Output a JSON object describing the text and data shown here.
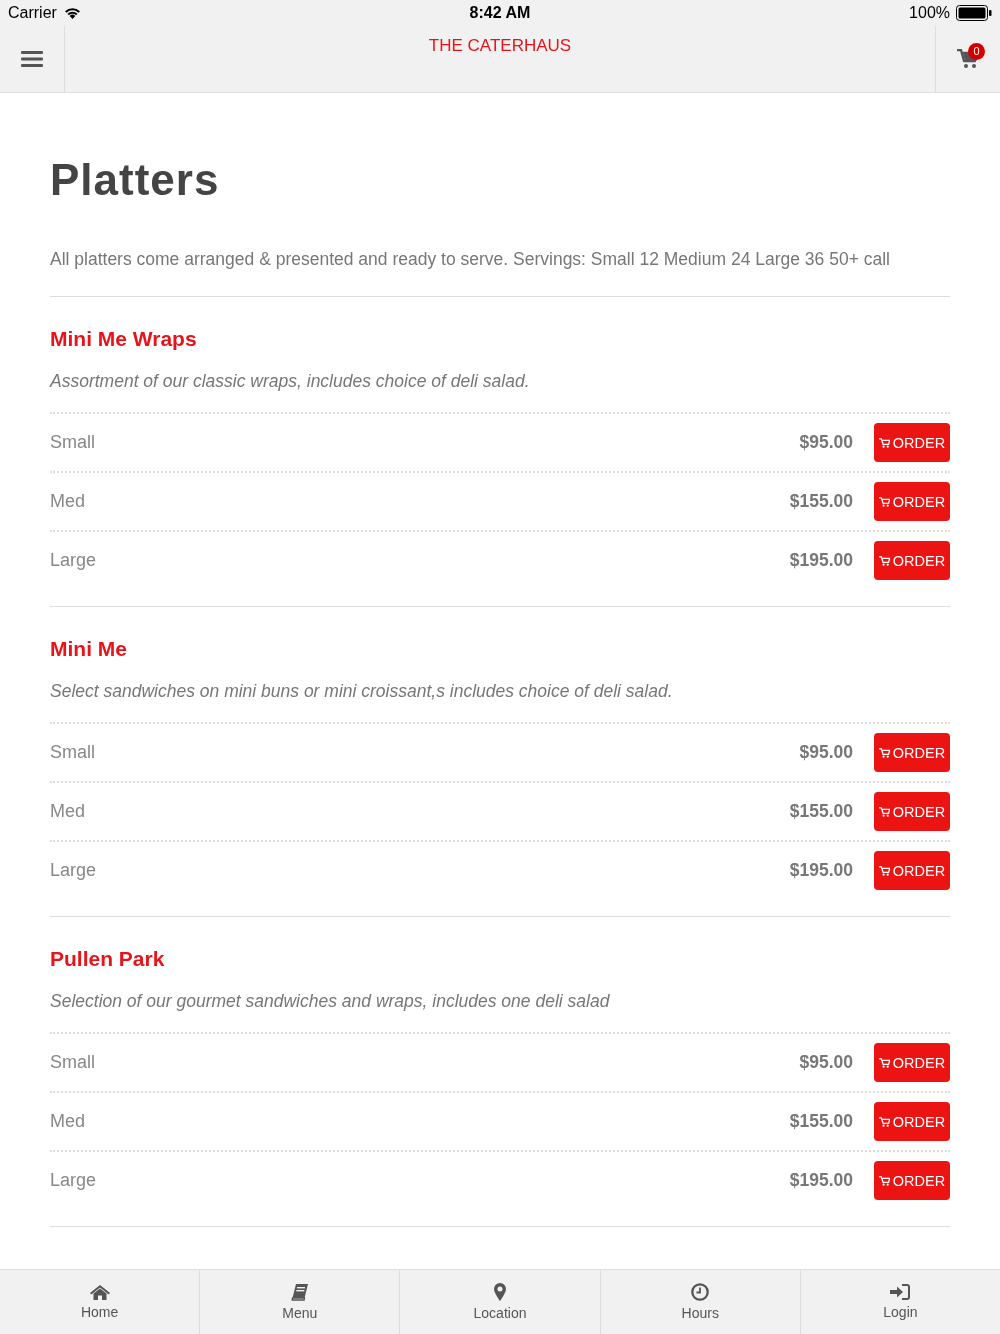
{
  "status_bar": {
    "carrier": "Carrier",
    "time": "8:42 AM",
    "battery": "100%"
  },
  "header": {
    "title": "THE CATERHAUS",
    "cart_count": "0"
  },
  "page": {
    "title": "Platters",
    "description": "All platters come arranged & presented and ready to serve. Servings: Small 12 Medium 24 Large 36 50+ call"
  },
  "sections": [
    {
      "name": "Mini Me Wraps",
      "description": "Assortment of our classic wraps, includes choice of deli salad.",
      "options": [
        {
          "size": "Small",
          "price": "$95.00",
          "button": "ORDER"
        },
        {
          "size": "Med",
          "price": "$155.00",
          "button": "ORDER"
        },
        {
          "size": "Large",
          "price": "$195.00",
          "button": "ORDER"
        }
      ]
    },
    {
      "name": "Mini Me",
      "description": "Select sandwiches on mini buns or mini croissant,s includes choice of deli salad.",
      "options": [
        {
          "size": "Small",
          "price": "$95.00",
          "button": "ORDER"
        },
        {
          "size": "Med",
          "price": "$155.00",
          "button": "ORDER"
        },
        {
          "size": "Large",
          "price": "$195.00",
          "button": "ORDER"
        }
      ]
    },
    {
      "name": "Pullen Park",
      "description": "Selection of our gourmet sandwiches and wraps, includes one deli salad",
      "options": [
        {
          "size": "Small",
          "price": "$95.00",
          "button": "ORDER"
        },
        {
          "size": "Med",
          "price": "$155.00",
          "button": "ORDER"
        },
        {
          "size": "Large",
          "price": "$195.00",
          "button": "ORDER"
        }
      ]
    }
  ],
  "tab_bar": [
    {
      "label": "Home"
    },
    {
      "label": "Menu"
    },
    {
      "label": "Location"
    },
    {
      "label": "Hours"
    },
    {
      "label": "Login"
    }
  ]
}
